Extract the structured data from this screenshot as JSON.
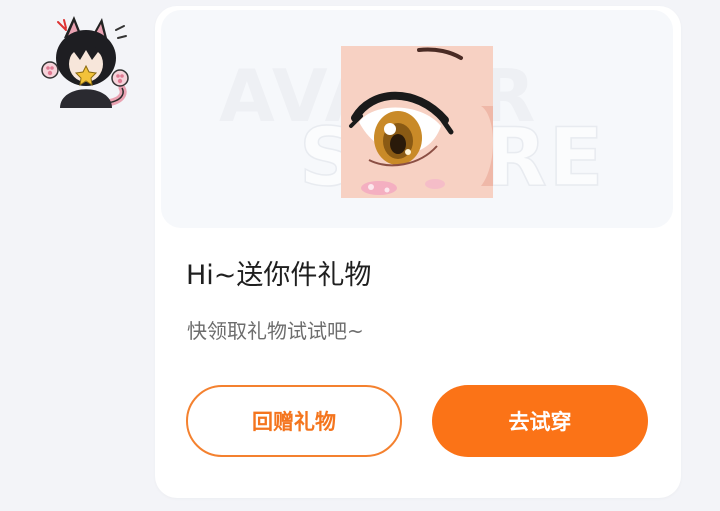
{
  "message": {
    "sender_avatar_icon": "anime-girl-cat-ears-avatar-icon",
    "banner": {
      "background_text_1": "AVATAR",
      "background_text_2": "STORE",
      "item_icon": "anime-eye-makeup-item-icon"
    },
    "title": "Hi~送你件礼物",
    "subtitle": "快领取礼物试试吧~",
    "buttons": {
      "return_gift_label": "回赠礼物",
      "try_on_label": "去试穿"
    }
  },
  "colors": {
    "accent": "#fb7317",
    "page_background": "#f3f4f8",
    "card_background": "#ffffff"
  }
}
